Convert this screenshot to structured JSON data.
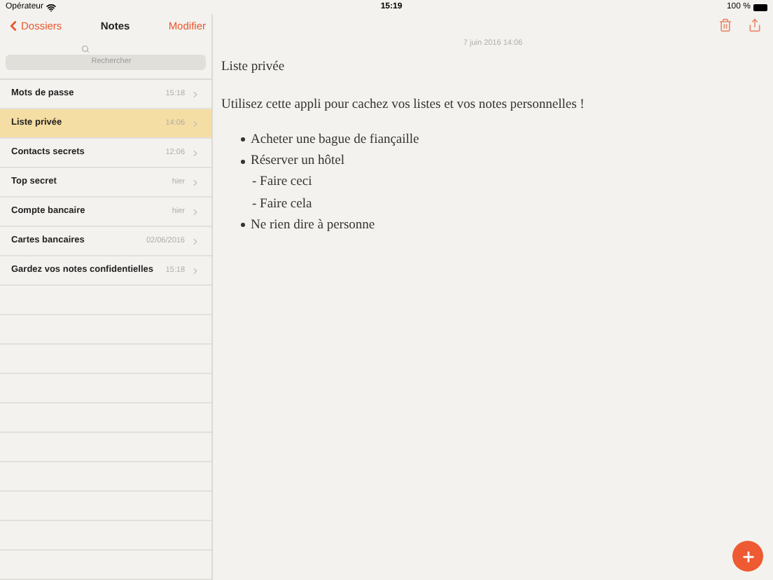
{
  "status_bar": {
    "carrier": "Opérateur",
    "time": "15:19",
    "battery": "100 %"
  },
  "nav": {
    "back": "Dossiers",
    "title": "Notes",
    "action": "Modifier"
  },
  "search": {
    "placeholder": "Rechercher"
  },
  "notes": [
    {
      "title": "Mots de passe",
      "date": "15:18",
      "selected": false
    },
    {
      "title": "Liste privée",
      "date": "14:06",
      "selected": true
    },
    {
      "title": "Contacts secrets",
      "date": "12:06",
      "selected": false
    },
    {
      "title": "Top secret",
      "date": "hier",
      "selected": false
    },
    {
      "title": "Compte bancaire",
      "date": "hier",
      "selected": false
    },
    {
      "title": "Cartes bancaires",
      "date": "02/06/2016",
      "selected": false
    },
    {
      "title": "Gardez vos notes confidentielles",
      "date": "15:18",
      "selected": false
    }
  ],
  "note": {
    "date": "7 juin 2016 14:06",
    "title": "Liste privée",
    "intro": "Utilisez cette appli pour cachez vos listes et vos notes personnelles !",
    "bullets": [
      {
        "text": "Acheter une bague de fiançaille"
      },
      {
        "text": "Réserver un hôtel",
        "children": [
          {
            "text": "- Faire ceci"
          },
          {
            "text": "- Faire cela"
          }
        ]
      },
      {
        "text": "Ne rien dire à personne"
      }
    ]
  }
}
